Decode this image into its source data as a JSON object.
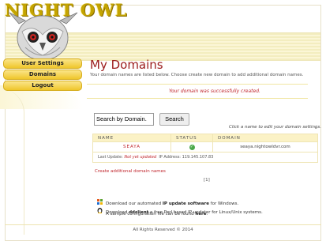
{
  "logo": {
    "text": "NIGHT OWL"
  },
  "sidebar": {
    "items": [
      {
        "label": "User Settings"
      },
      {
        "label": "Domains"
      },
      {
        "label": "Logout"
      }
    ]
  },
  "main": {
    "title": "My Domains",
    "subtitle": "Your domain names are listed below. Choose create new domain to add additional domain names.",
    "success": "Your domain was successfully created.",
    "search": {
      "value": "Search by Domain.",
      "button": "Search"
    },
    "hint": "Click a name to edit your domain settings.",
    "table": {
      "headers": [
        "NAME",
        "STATUS",
        "DOMAIN"
      ],
      "rows": [
        {
          "name": "SEAYA",
          "status": "ok",
          "domain": "seaya.nightowldvr.com"
        }
      ],
      "update": {
        "label": "Last Update:",
        "value": "Not yet updated",
        "ip_label": "IP Address:",
        "ip": "119.145.107.83"
      }
    },
    "create_link": "Create additional domain names",
    "pager": "[1]",
    "downloads": [
      {
        "pre": "Download our automated ",
        "bold": "IP update software",
        "post": " for Windows."
      },
      {
        "pre": "Download ",
        "bold": "ddclient",
        "post": " a free Perl based IP updater for Linux/Unix systems."
      },
      {
        "pre": "A sample configuration file can be found ",
        "bold": "here",
        "post": "."
      }
    ]
  },
  "footer": "All Rights Reserved © 2014"
}
